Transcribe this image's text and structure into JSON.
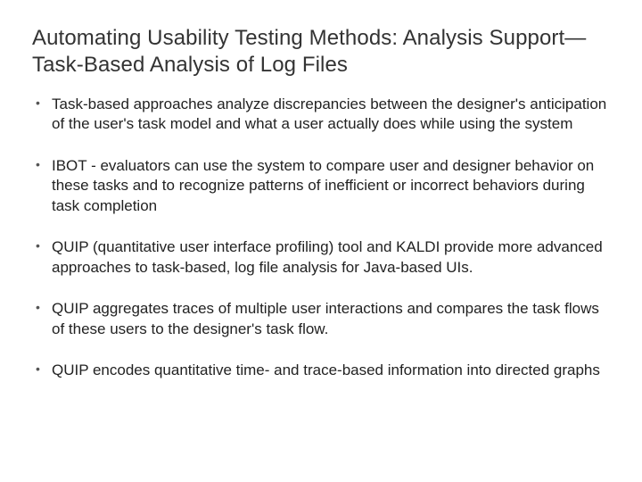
{
  "title": "Automating Usability Testing Methods: Analysis Support—Task-Based Analysis of Log Files",
  "bullets": [
    "Task-based approaches analyze discrepancies between the designer's anticipation of the user's task model and what a user actually does while using the system",
    "IBOT - evaluators can use the system to compare user and designer behavior on these tasks and to recognize patterns of inefficient or incorrect behaviors during task completion",
    "QUIP (quantitative user interface profiling) tool and KALDI provide more advanced approaches to task-based, log file analysis for Java-based UIs.",
    "QUIP aggregates traces of multiple user interactions and compares the task flows of these users to the designer's task flow.",
    "QUIP encodes quantitative time- and trace-based information into directed graphs"
  ]
}
